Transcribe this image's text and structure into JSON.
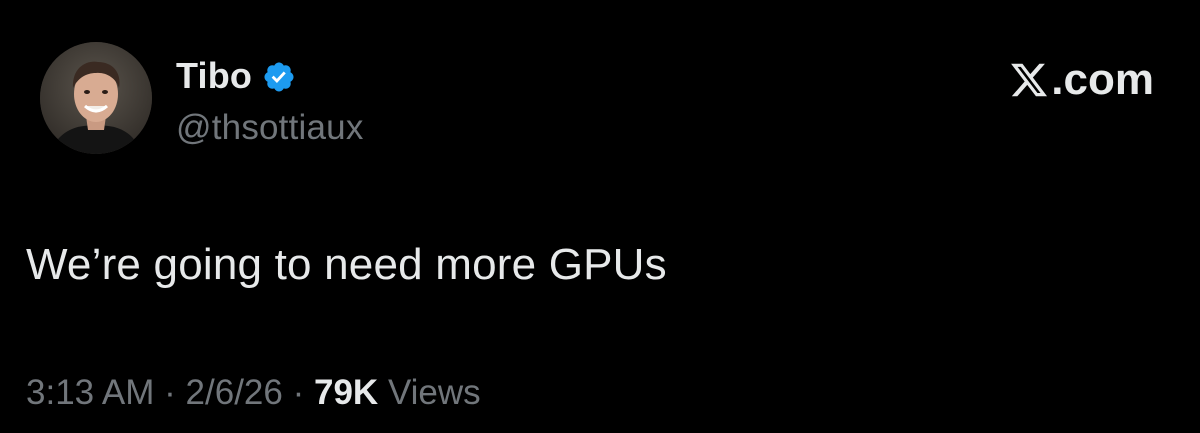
{
  "tweet": {
    "author": {
      "display_name": "Tibo",
      "handle": "@thsottiaux",
      "verified": true,
      "verified_icon": "verified-badge-icon",
      "verified_color": "#1d9bf0"
    },
    "brand": {
      "logo_icon": "x-logo-icon",
      "suffix": ".com"
    },
    "text": "We’re going to need more GPUs",
    "meta": {
      "time": "3:13 AM",
      "separator": "·",
      "date": "2/6/26",
      "views_count": "79K",
      "views_label": "Views"
    }
  },
  "colors": {
    "background": "#000000",
    "primary_text": "#e7e9ea",
    "secondary_text": "#71767b",
    "accent": "#1d9bf0"
  }
}
